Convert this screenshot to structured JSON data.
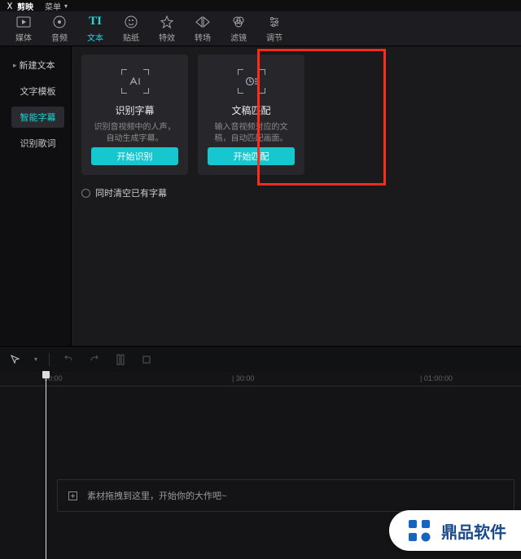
{
  "menubar": {
    "app_name": "剪映",
    "menu_label": "菜单"
  },
  "tabs": [
    {
      "id": "media",
      "label": "媒体"
    },
    {
      "id": "audio",
      "label": "音频"
    },
    {
      "id": "text",
      "label": "文本"
    },
    {
      "id": "sticker",
      "label": "贴纸"
    },
    {
      "id": "effect",
      "label": "特效"
    },
    {
      "id": "transition",
      "label": "转场"
    },
    {
      "id": "filter",
      "label": "滤镜"
    },
    {
      "id": "adjust",
      "label": "调节"
    }
  ],
  "sidebar": {
    "items": [
      {
        "id": "new-text",
        "label": "新建文本"
      },
      {
        "id": "text-template",
        "label": "文字模板"
      },
      {
        "id": "smart-subtitle",
        "label": "智能字幕"
      },
      {
        "id": "recognize-lyric",
        "label": "识别歌词"
      }
    ]
  },
  "cards": {
    "recognize": {
      "title": "识别字幕",
      "desc": "识别音视频中的人声，自动生成字幕。",
      "button": "开始识别"
    },
    "match": {
      "title": "文稿匹配",
      "desc": "输入音视频对应的文稿，自动匹配画面。",
      "button": "开始匹配"
    }
  },
  "clear_subtitle_label": "同时清空已有字幕",
  "ruler": {
    "t0": "00:00",
    "t1": "| 30:00",
    "t2": "| 01:00:00"
  },
  "track_hint": "素材拖拽到这里，开始你的大作吧~",
  "watermark": "鼎品软件"
}
